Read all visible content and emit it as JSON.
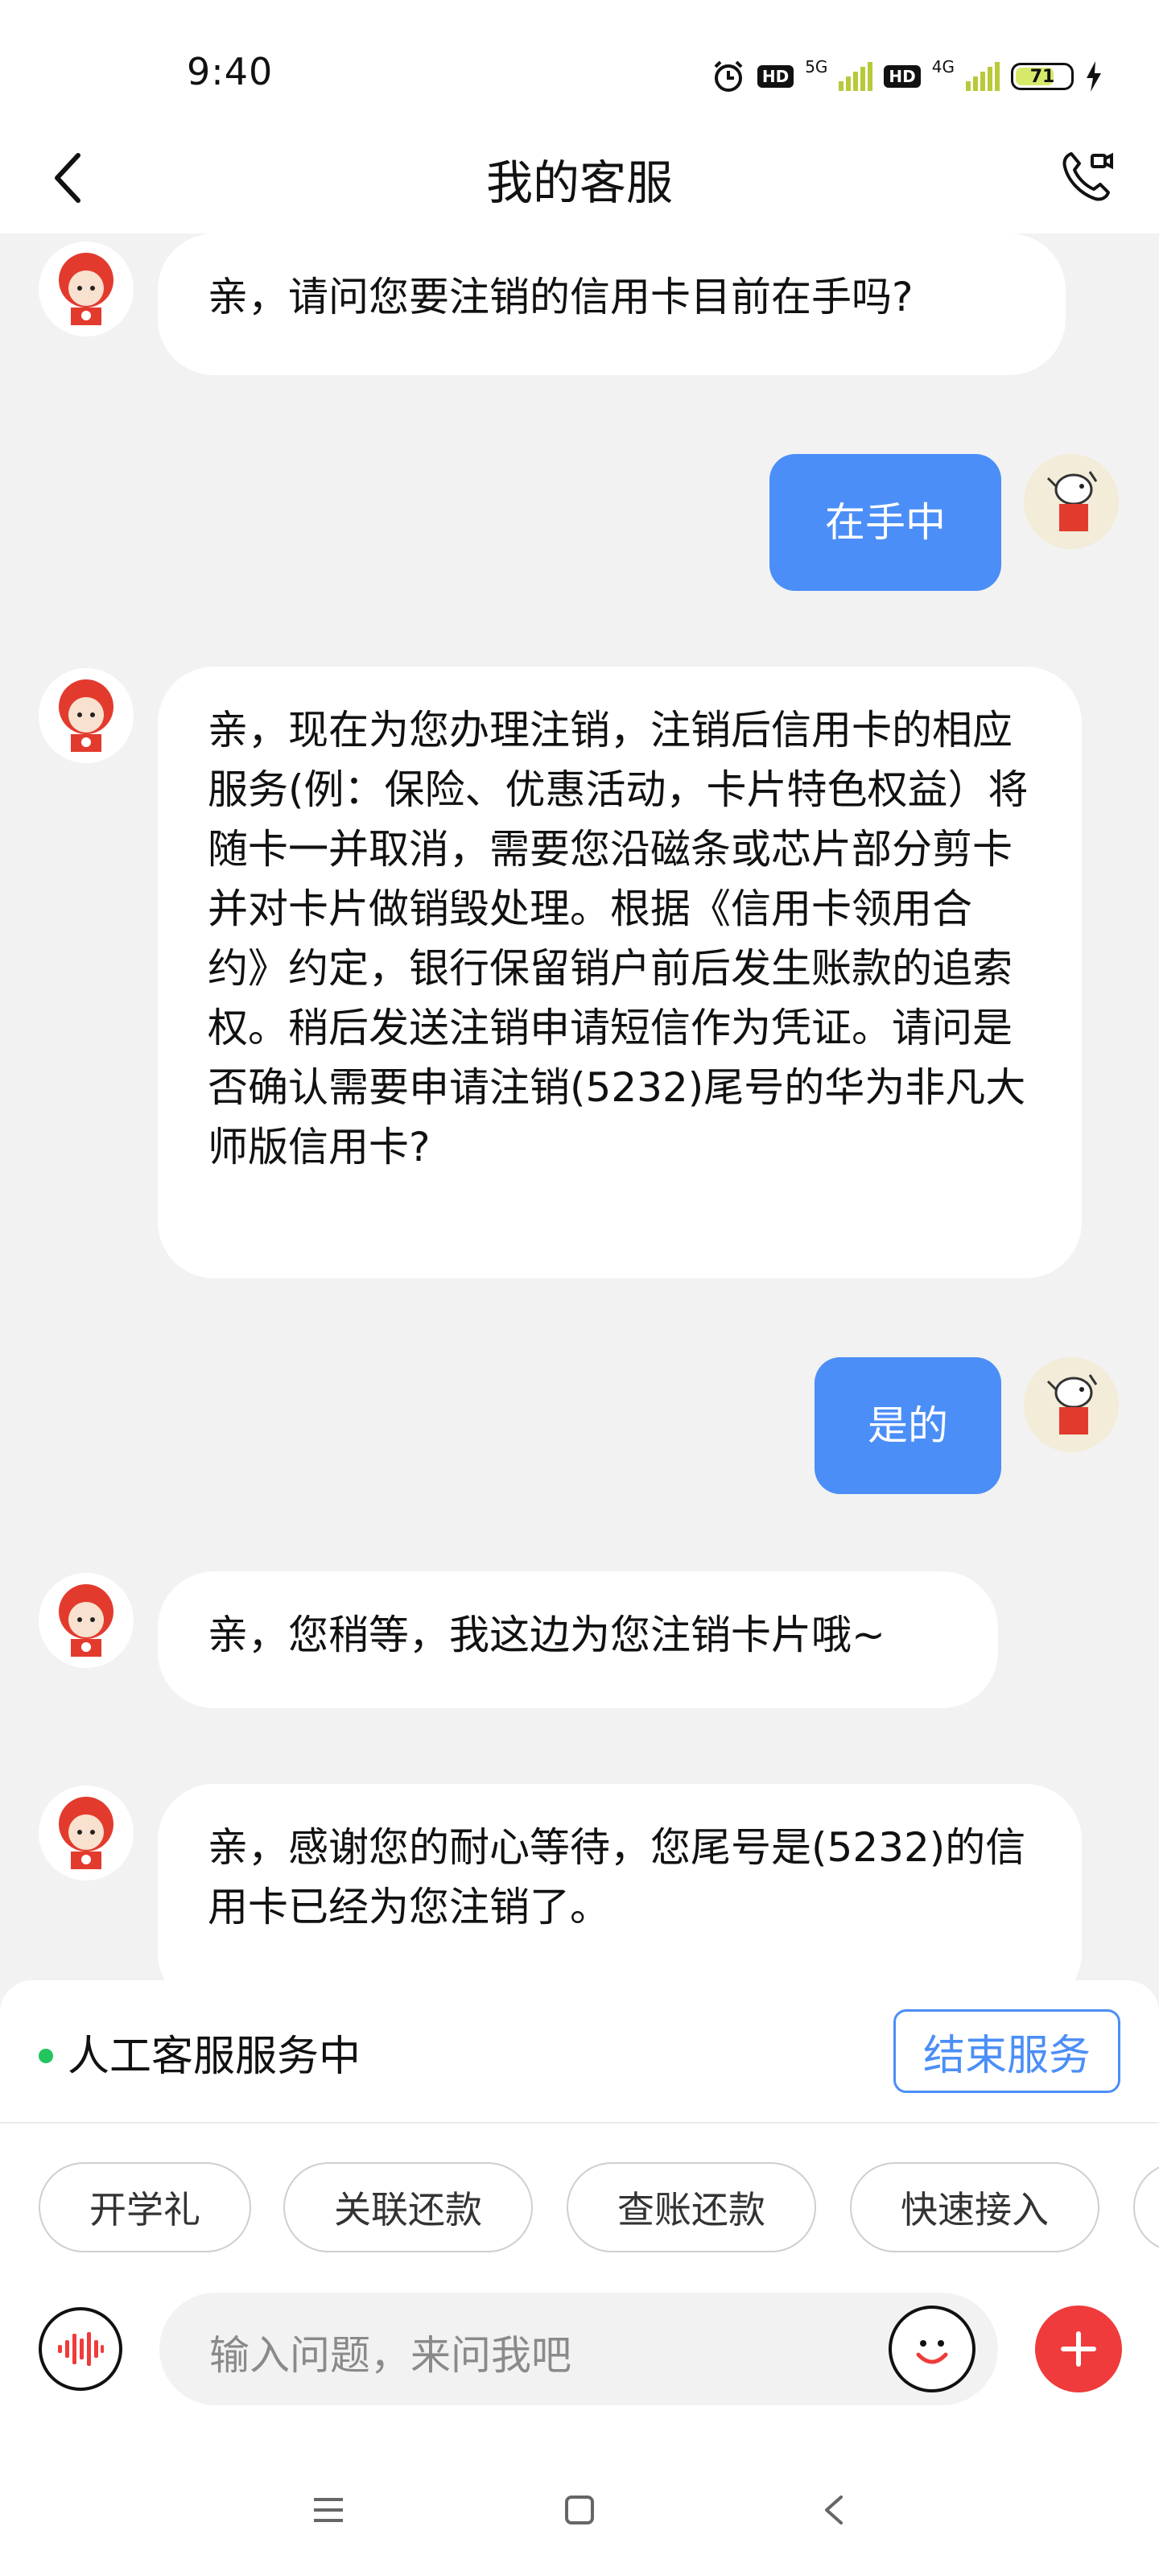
{
  "status_bar": {
    "time": "9:40",
    "hd_badge": "HD",
    "network_1": "5G",
    "network_2": "4G",
    "battery": "71",
    "battery_level": 0.71,
    "signal_color": "#b8c93a"
  },
  "header": {
    "title": "我的客服",
    "back_icon": "chevron-left-icon",
    "call_icon": "phone-video-icon"
  },
  "messages": [
    {
      "sender": "bot",
      "text": "亲，请问您要注销的信用卡目前在手吗?"
    },
    {
      "sender": "user",
      "text": "在手中"
    },
    {
      "sender": "bot",
      "text": "亲，现在为您办理注销，注销后信用卡的相应服务(例：保险、优惠活动，卡片特色权益）将随卡一并取消，需要您沿磁条或芯片部分剪卡并对卡片做销毁处理。根据《信用卡领用合约》约定，银行保留销户前后发生账款的追索权。稍后发送注销申请短信作为凭证。请问是否确认需要申请注销(5232)尾号的华为非凡大师版信用卡?"
    },
    {
      "sender": "user",
      "text": "是的"
    },
    {
      "sender": "bot",
      "text": "亲，您稍等，我这边为您注销卡片哦~"
    },
    {
      "sender": "bot",
      "text": "亲，感谢您的耐心等待，您尾号是(5232)的信用卡已经为您注销了。"
    }
  ],
  "service": {
    "status_text": "人工客服服务中",
    "end_button": "结束服务",
    "status_color": "#22c55e"
  },
  "quick_chips": [
    "开学礼",
    "关联还款",
    "查账还款",
    "快速接入"
  ],
  "input": {
    "placeholder": "输入问题，来问我吧",
    "voice_icon": "voice-wave-icon",
    "emoji_icon": "smile-icon",
    "plus_icon": "plus-icon"
  },
  "colors": {
    "accent": "#4b8ef7",
    "plus": "#ef3b3b",
    "background": "#f2f2f2"
  },
  "nav": {
    "menu_icon": "menu-icon",
    "home_icon": "square-icon",
    "back_icon": "back-triangle-icon"
  }
}
